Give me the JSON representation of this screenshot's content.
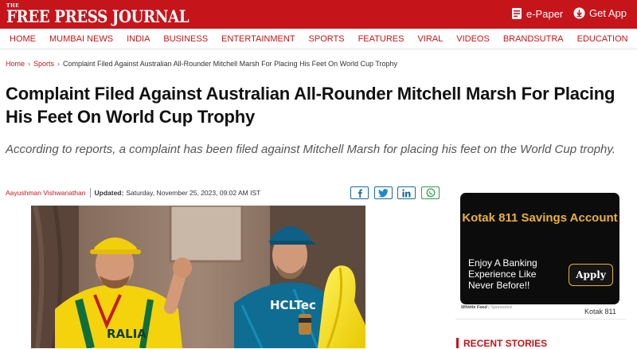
{
  "header": {
    "logo_small": "THE",
    "logo_text": "FREE PRESS JOURNAL",
    "epaper_label": "e-Paper",
    "getapp_label": "Get App"
  },
  "nav": [
    "HOME",
    "MUMBAI NEWS",
    "INDIA",
    "BUSINESS",
    "ENTERTAINMENT",
    "SPORTS",
    "FEATURES",
    "VIRAL",
    "VIDEOS",
    "BRANDSUTRA",
    "EDUCATION"
  ],
  "breadcrumb": {
    "home": "Home",
    "section": "Sports",
    "current": "Complaint Filed Against Australian All-Rounder Mitchell Marsh For Placing His Feet On World Cup Trophy"
  },
  "article": {
    "headline": "Complaint Filed Against Australian All-Rounder Mitchell Marsh For Placing His Feet On World Cup Trophy",
    "summary": "According to reports, a complaint has been filed against Mitchell Marsh for placing his feet on the World Cup trophy.",
    "author": "Aayushman Vishwanathan",
    "updated_label": "Updated:",
    "updated_date": "Saturday, November 25, 2023, 09:02 AM IST",
    "photo_jersey_left": "RALIA",
    "photo_jersey_right": "HCLTec"
  },
  "share": [
    "facebook-icon",
    "twitter-icon",
    "linkedin-icon",
    "whatsapp-icon"
  ],
  "ad": {
    "title": "Kotak 811 Savings Account",
    "body": "Enjoy A Banking Experience Like Never Before!!",
    "cta": "Apply",
    "credit_brand": "Whittle Feed",
    "credit_rest": " | Sponsored",
    "brand": "Kotak 811"
  },
  "sidebar": {
    "recent_title": "RECENT STORIES"
  },
  "colors": {
    "brand_red": "#c6141b",
    "ad_gold": "#e9b233"
  }
}
